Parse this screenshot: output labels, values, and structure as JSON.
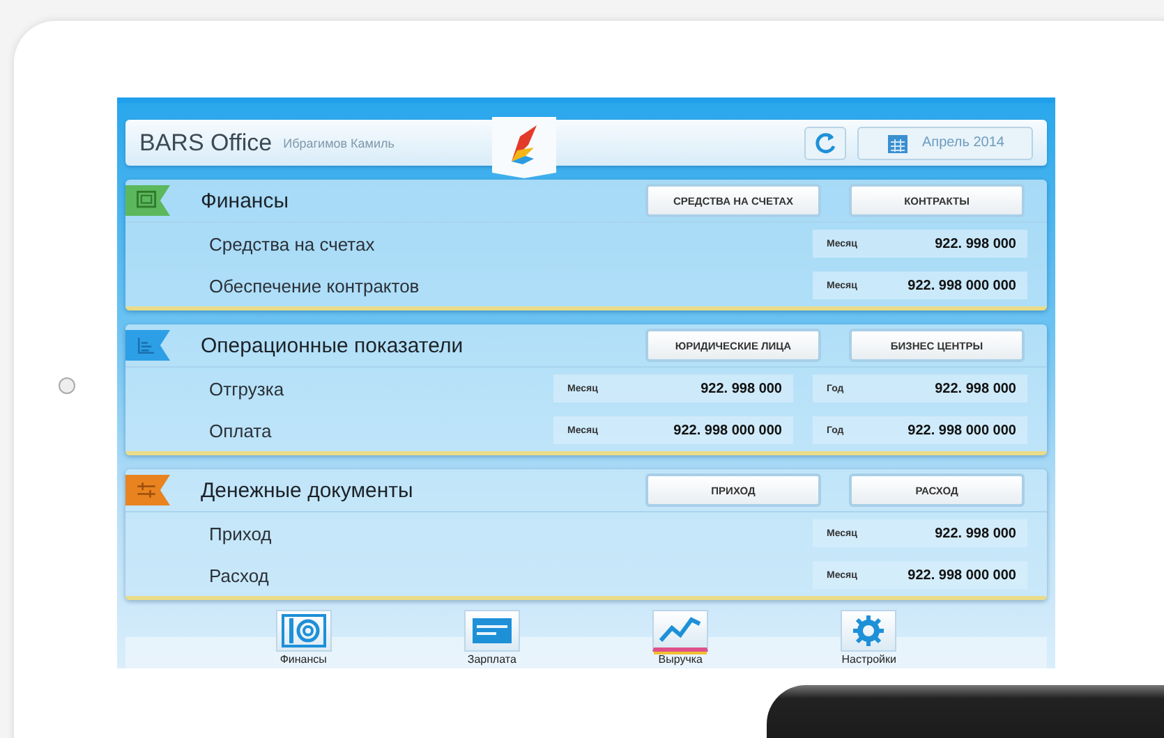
{
  "header": {
    "app_title": "BARS Office",
    "user": "Ибрагимов Камиль",
    "month_button": "Апрель 2014"
  },
  "sections": [
    {
      "title": "Финансы",
      "color": "#5cb85c",
      "buttons": [
        "СРЕДСТВА НА СЧЕТАХ",
        "КОНТРАКТЫ"
      ],
      "rows": [
        {
          "label": "Средства на счетах",
          "cells": [
            {
              "period": "Месяц",
              "value": "922. 998 000"
            }
          ]
        },
        {
          "label": "Обеспечение контрактов",
          "cells": [
            {
              "period": "Месяц",
              "value": "922. 998 000 000"
            }
          ]
        }
      ]
    },
    {
      "title": "Операционные показатели",
      "color": "#2d9fe6",
      "buttons": [
        "ЮРИДИЧЕСКИЕ ЛИЦА",
        "БИЗНЕС ЦЕНТРЫ"
      ],
      "rows": [
        {
          "label": "Отгрузка",
          "cells": [
            {
              "period": "Месяц",
              "value": "922. 998 000"
            },
            {
              "period": "Год",
              "value": "922. 998 000"
            }
          ]
        },
        {
          "label": "Оплата",
          "cells": [
            {
              "period": "Месяц",
              "value": "922. 998 000 000"
            },
            {
              "period": "Год",
              "value": "922. 998 000 000"
            }
          ]
        }
      ]
    },
    {
      "title": "Денежные документы",
      "color": "#e8831f",
      "buttons": [
        "ПРИХОД",
        "РАСХОД"
      ],
      "rows": [
        {
          "label": "Приход",
          "cells": [
            {
              "period": "Месяц",
              "value": "922. 998 000"
            }
          ]
        },
        {
          "label": "Расход",
          "cells": [
            {
              "period": "Месяц",
              "value": "922. 998 000 000"
            }
          ]
        }
      ]
    }
  ],
  "tabs": [
    {
      "label": "Финансы",
      "selected": false
    },
    {
      "label": "Зарплата",
      "selected": false
    },
    {
      "label": "Выручка",
      "selected": true
    },
    {
      "label": "Настройки",
      "selected": false
    }
  ]
}
